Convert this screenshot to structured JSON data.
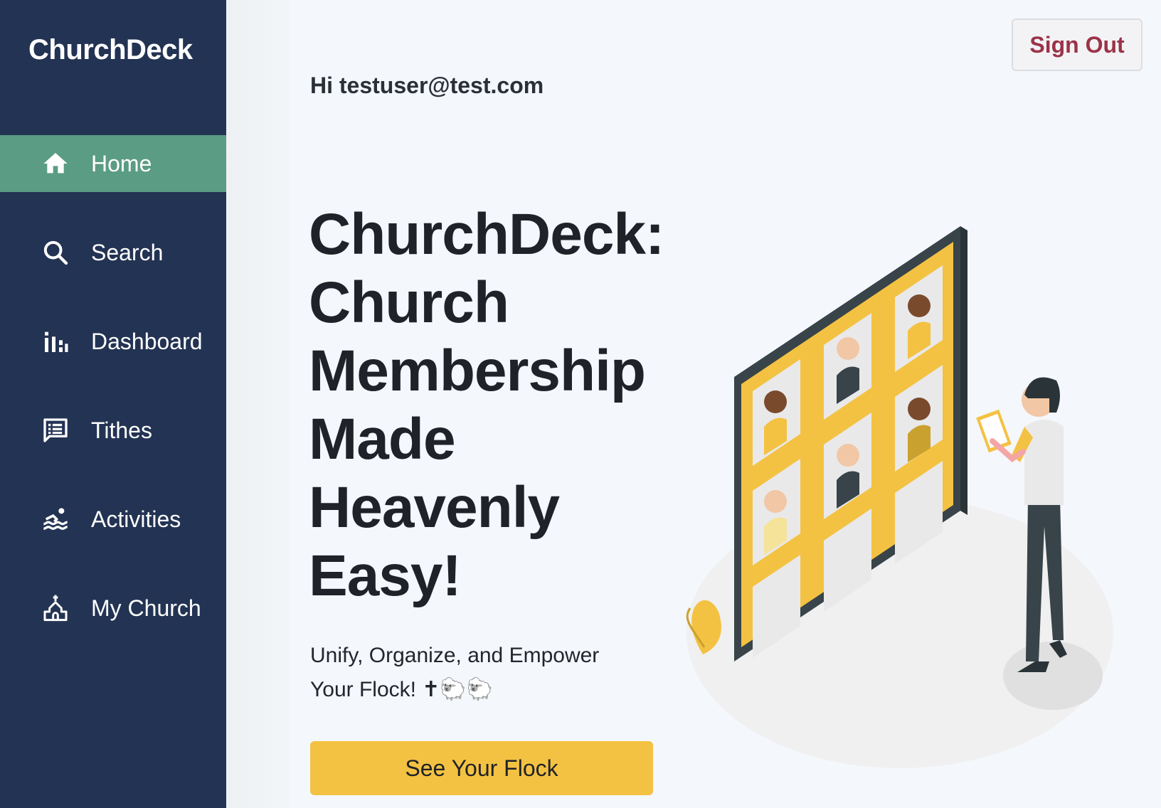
{
  "sidebar": {
    "brand": "ChurchDeck",
    "items": [
      {
        "label": "Home",
        "icon": "home-icon",
        "active": true
      },
      {
        "label": "Search",
        "icon": "search-icon",
        "active": false
      },
      {
        "label": "Dashboard",
        "icon": "dashboard-icon",
        "active": false
      },
      {
        "label": "Tithes",
        "icon": "tithes-icon",
        "active": false
      },
      {
        "label": "Activities",
        "icon": "activities-icon",
        "active": false
      },
      {
        "label": "My Church",
        "icon": "church-icon",
        "active": false
      }
    ]
  },
  "header": {
    "signout_label": "Sign Out",
    "greeting": "Hi testuser@test.com"
  },
  "hero": {
    "headline": "ChurchDeck: Church Membership Made Heavenly Easy!",
    "subtitle": "Unify, Organize, and Empower Your Flock! ✝🐑🐑",
    "cta_label": "See Your Flock"
  },
  "colors": {
    "sidebar_bg": "#233353",
    "active_bg": "#5b9c84",
    "accent_yellow": "#f4c242",
    "signout_text": "#9b3348",
    "page_bg": "#f4f7fc"
  }
}
